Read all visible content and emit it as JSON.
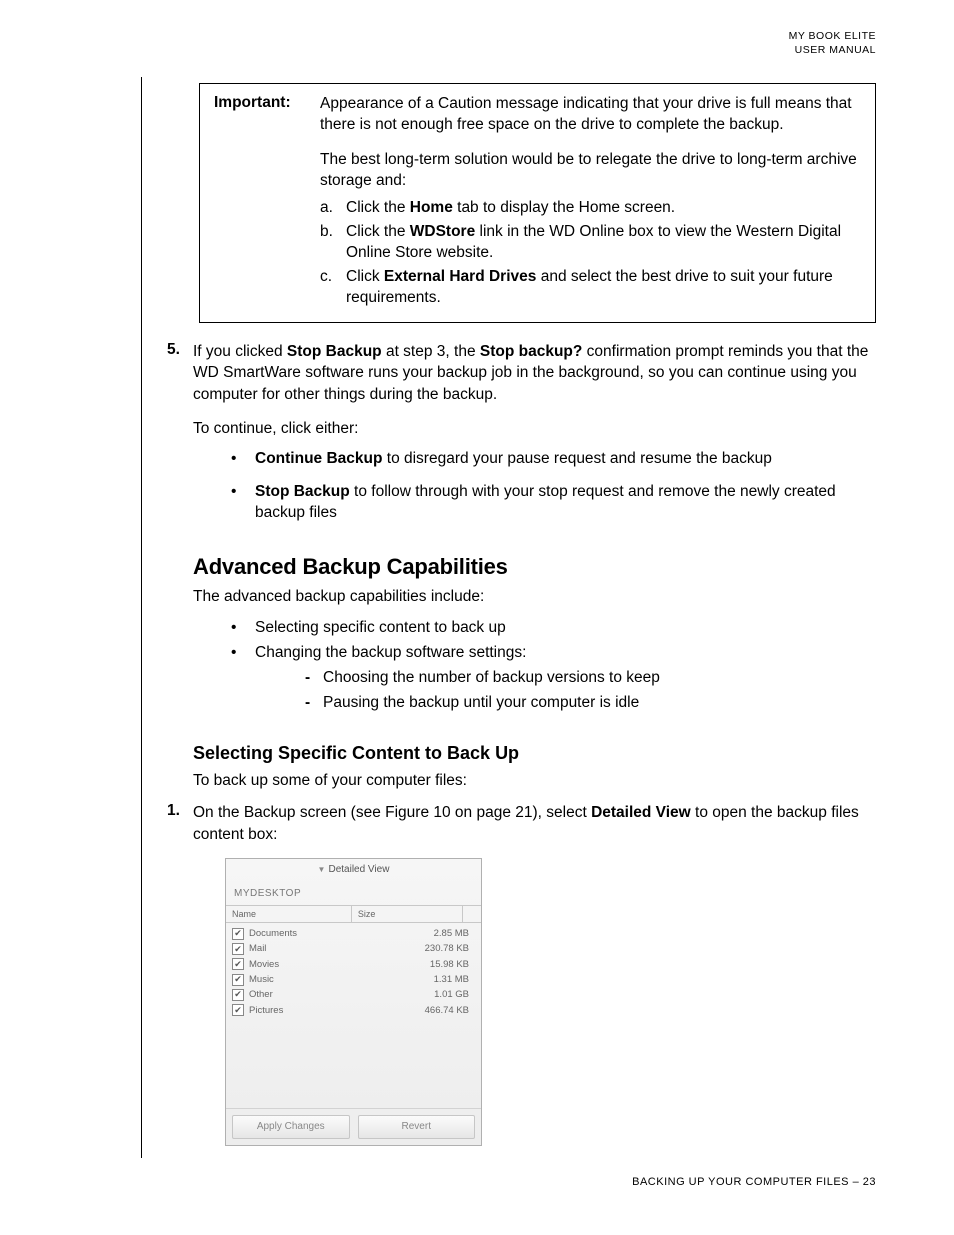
{
  "header": {
    "line1": "MY BOOK ELITE",
    "line2": "USER MANUAL"
  },
  "footer": {
    "text": "BACKING UP YOUR COMPUTER FILES – 23"
  },
  "important": {
    "label": "Important:",
    "p1": "Appearance of a Caution message indicating that your drive is full means that there is not enough free space on the drive to complete the backup.",
    "p2": "The best long-term solution would be to relegate the drive to long-term archive storage and:",
    "items": {
      "a": {
        "mk": "a.",
        "pre": "Click the ",
        "bold": "Home",
        "post": " tab to display the Home screen."
      },
      "b": {
        "mk": "b.",
        "pre": "Click the ",
        "bold": "WDStore",
        "post": " link in the WD Online box to view the Western Digital Online Store website."
      },
      "c": {
        "mk": "c.",
        "pre": "Click ",
        "bold": "External Hard Drives",
        "post": " and select the best drive to suit your future requirements."
      }
    }
  },
  "step5": {
    "num": "5.",
    "l1a": "If you clicked ",
    "l1b": "Stop Backup",
    "l1c": " at step 3, the ",
    "l1d": "Stop backup?",
    "l1e": " confirmation prompt reminds you that the WD SmartWare software runs your backup job in the background, so you can continue using you computer for other things during the backup.",
    "l2": "To continue, click either:",
    "bul1": {
      "b": "Continue Backup",
      "t": " to disregard your pause request and resume the backup"
    },
    "bul2": {
      "b": "Stop Backup",
      "t": " to follow through with your stop request and remove the newly created backup files"
    }
  },
  "sec1": {
    "title": "Advanced Backup Capabilities",
    "intro": "The advanced backup capabilities include:",
    "b1": "Selecting specific content to back up",
    "b2": "Changing the backup software settings:",
    "d1": "Choosing the number of backup versions to keep",
    "d2": "Pausing the backup until your computer is idle"
  },
  "sec2": {
    "title": "Selecting Specific Content to Back Up",
    "intro": "To back up some of your computer files:",
    "step1": {
      "num": "1.",
      "a": "On the Backup screen (see Figure 10 on page 21), select ",
      "b": "Detailed View",
      "c": " to open the backup files content box:"
    }
  },
  "shot": {
    "title": "Detailed View",
    "device": "MYDESKTOP",
    "colName": "Name",
    "colSize": "Size",
    "rows": [
      {
        "name": "Documents",
        "size": "2.85 MB"
      },
      {
        "name": "Mail",
        "size": "230.78 KB"
      },
      {
        "name": "Movies",
        "size": "15.98 KB"
      },
      {
        "name": "Music",
        "size": "1.31 MB"
      },
      {
        "name": "Other",
        "size": "1.01 GB"
      },
      {
        "name": "Pictures",
        "size": "466.74 KB"
      }
    ],
    "btnApply": "Apply Changes",
    "btnRevert": "Revert"
  }
}
